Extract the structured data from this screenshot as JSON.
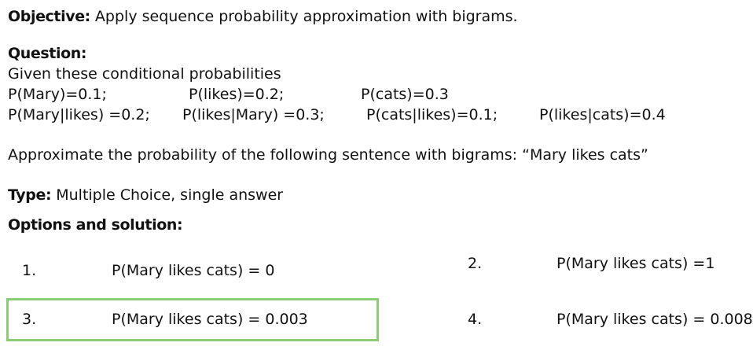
{
  "objective": {
    "label": "Objective:",
    "text": " Apply sequence probability approximation with bigrams."
  },
  "question": {
    "label": "Question:",
    "intro": "Given these conditional probabilities",
    "probs_row1": [
      "P(Mary)=0.1;",
      "P(likes)=0.2;",
      "P(cats)=0.3"
    ],
    "probs_row2": [
      "P(Mary|likes) =0.2;",
      "P(likes|Mary) =0.3;",
      "P(cats|likes)=0.1;",
      "P(likes|cats)=0.4"
    ],
    "prompt": "Approximate the probability of the following sentence with bigrams: “Mary likes cats”"
  },
  "type": {
    "label": "Type:",
    "text": " Multiple Choice, single answer"
  },
  "options_heading": "Options and solution:",
  "options": [
    {
      "num": "1.",
      "text": "P(Mary likes cats) = 0"
    },
    {
      "num": "2.",
      "text": "P(Mary likes cats) =1"
    },
    {
      "num": "3.",
      "text": "P(Mary likes cats) = 0.003",
      "highlighted": true
    },
    {
      "num": "4.",
      "text": "P(Mary likes cats) = 0.008"
    }
  ],
  "colors": {
    "highlight_border": "#8ccc75",
    "text": "#111111"
  }
}
